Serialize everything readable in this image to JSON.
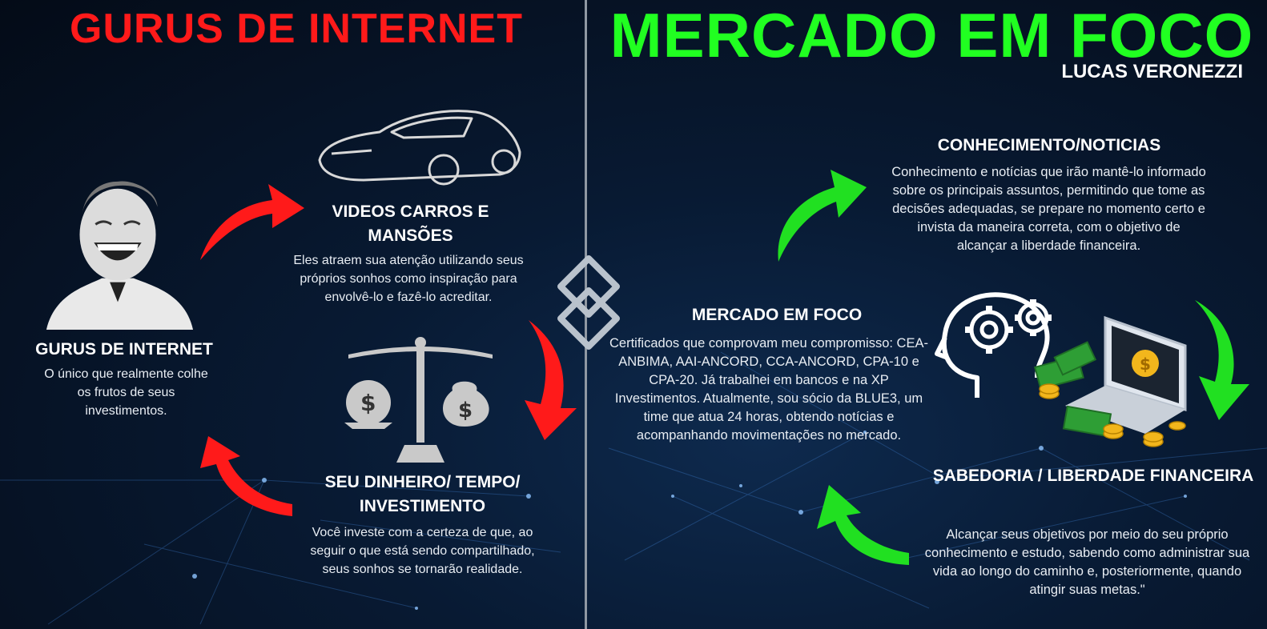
{
  "left": {
    "title": "GURUS DE INTERNET",
    "videos": {
      "heading": "VIDEOS CARROS E MANSÕES",
      "text": "Eles atraem sua atenção utilizando seus próprios sonhos como inspiração para envolvê-lo e fazê-lo acreditar."
    },
    "gurus": {
      "heading": "GURUS DE INTERNET",
      "text": "O único que realmente colhe os frutos de seus investimentos."
    },
    "money": {
      "heading": "SEU DINHEIRO/ TEMPO/ INVESTIMENTO",
      "text": "Você investe com a certeza de que, ao seguir o que está sendo compartilhado, seus sonhos se tornarão realidade."
    }
  },
  "right": {
    "title": "MERCADO EM FOCO",
    "author": "LUCAS VERONEZZI",
    "knowledge": {
      "heading": "CONHECIMENTO/NOTICIAS",
      "text": "Conhecimento e notícias que irão mantê-lo informado sobre os principais assuntos, permitindo que tome as decisões adequadas, se prepare no momento certo e invista da maneira correta, com o objetivo de alcançar a liberdade financeira."
    },
    "market": {
      "heading": "MERCADO EM FOCO",
      "text": "Certificados que comprovam meu compromisso: CEA-ANBIMA, AAI-ANCORD, CCA-ANCORD, CPA-10 e CPA-20. Já trabalhei em bancos e na XP Investimentos. Atualmente, sou sócio da BLUE3, um time que atua 24 horas, obtendo notícias e acompanhando movimentações no mercado."
    },
    "wisdom": {
      "heading": "SABEDORIA / LIBERDADE FINANCEIRA",
      "text": "Alcançar seus objetivos por meio do seu próprio conhecimento e estudo, sabendo como administrar sua vida ao longo do caminho e, posteriormente, quando atingir suas metas.\""
    }
  },
  "colors": {
    "red": "#ff1a1a",
    "green": "#21ff21",
    "background": "#081a33"
  },
  "icons": [
    "laughing-man-icon",
    "sports-car-icon",
    "money-scale-icon",
    "chain-link-icon",
    "head-gears-icon",
    "laptop-money-icon"
  ]
}
